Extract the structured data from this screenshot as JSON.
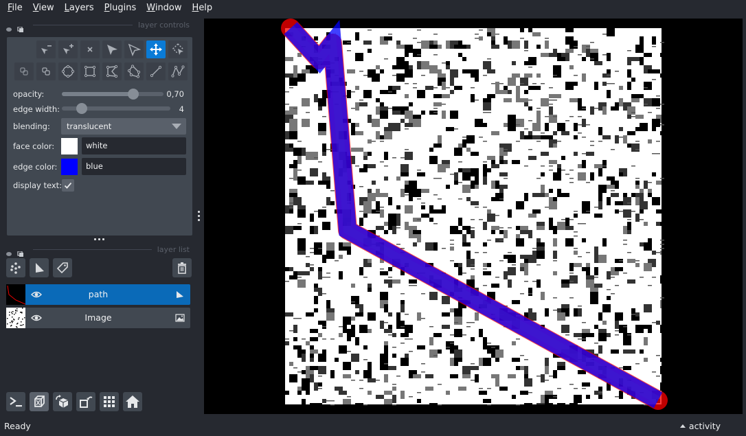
{
  "menu": {
    "items": [
      {
        "label": "File",
        "mnemonic": "F",
        "rest": "ile"
      },
      {
        "label": "View",
        "mnemonic": "V",
        "rest": "iew"
      },
      {
        "label": "Layers",
        "mnemonic": "L",
        "rest": "ayers"
      },
      {
        "label": "Plugins",
        "mnemonic": "P",
        "rest": "lugins"
      },
      {
        "label": "Window",
        "mnemonic": "W",
        "rest": "indow"
      },
      {
        "label": "Help",
        "mnemonic": "H",
        "rest": "elp"
      }
    ]
  },
  "layer_controls": {
    "title": "layer controls",
    "tools_row1": [
      "remove-vertex",
      "add-vertex",
      "delete-shape",
      "select-shape",
      "select-vertex",
      "pan-zoom",
      "transform"
    ],
    "tools_row2": [
      "move-back",
      "move-front",
      "add-ellipse",
      "add-rectangle",
      "add-polygon-lasso",
      "add-polygon",
      "add-line",
      "add-path"
    ],
    "active_tool": "pan-zoom",
    "opacity": {
      "label": "opacity:",
      "value": 0.7,
      "display": "0,70"
    },
    "edge_width": {
      "label": "edge width:",
      "value": 4,
      "min": 0,
      "max": 40,
      "display": "4"
    },
    "blending": {
      "label": "blending:",
      "value": "translucent"
    },
    "face_color": {
      "label": "face color:",
      "value": "white",
      "swatch": "#ffffff"
    },
    "edge_color": {
      "label": "edge color:",
      "value": "blue",
      "swatch": "#0000ff"
    },
    "display_text": {
      "label": "display text:",
      "checked": true
    }
  },
  "layer_list": {
    "title": "layer list",
    "buttons": [
      "new-points-layer",
      "new-shapes-layer",
      "new-labels-layer",
      "delete-layer"
    ],
    "layers": [
      {
        "name": "path",
        "type": "shapes",
        "visible": true,
        "selected": true
      },
      {
        "name": "Image",
        "type": "image",
        "visible": true,
        "selected": false
      }
    ]
  },
  "viewer_buttons": [
    "console",
    "ndisplay-3d",
    "roll-dims",
    "transpose-dims",
    "grid-view",
    "reset-view"
  ],
  "canvas": {
    "path_layer": {
      "edge_color": "#0000ff",
      "highlight_color": "#ff0000"
    }
  },
  "status": {
    "text": "Ready",
    "activity_label": "activity"
  }
}
